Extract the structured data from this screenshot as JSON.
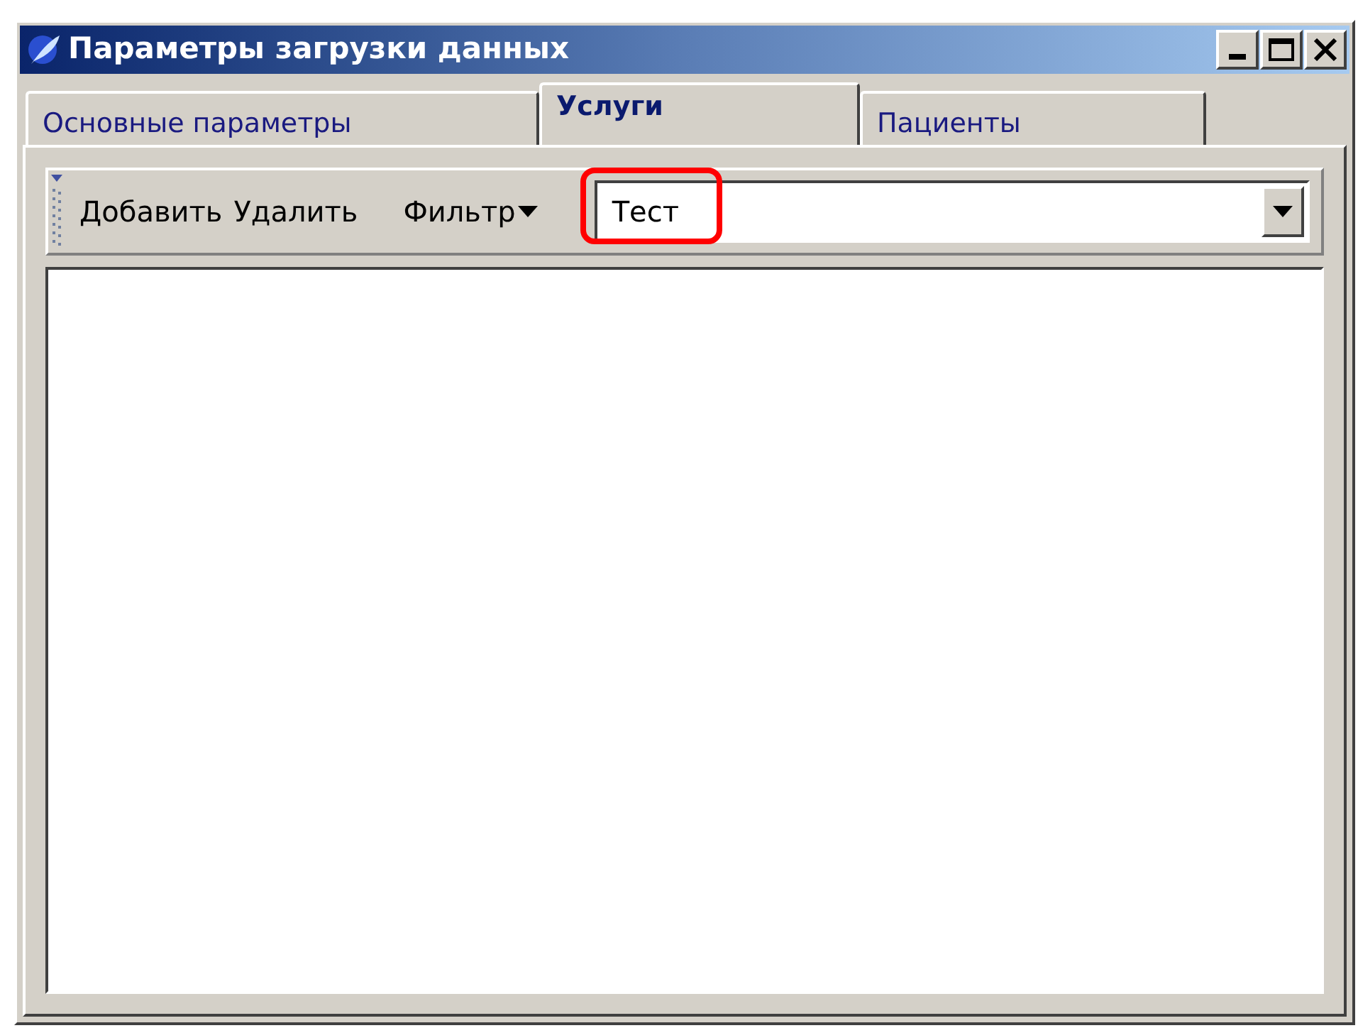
{
  "window": {
    "title": "Параметры загрузки данных"
  },
  "tabs": [
    {
      "label": "Основные параметры",
      "selected": false
    },
    {
      "label": "Услуги",
      "selected": true
    },
    {
      "label": "Пациенты",
      "selected": false
    }
  ],
  "toolbar": {
    "buttons": [
      {
        "label": "Добавить",
        "kind": "plain"
      },
      {
        "label": "Удалить",
        "kind": "plain"
      },
      {
        "label": "Фильтр",
        "kind": "dropdown"
      }
    ],
    "combo": {
      "value": "Тест",
      "highlighted": true
    }
  }
}
